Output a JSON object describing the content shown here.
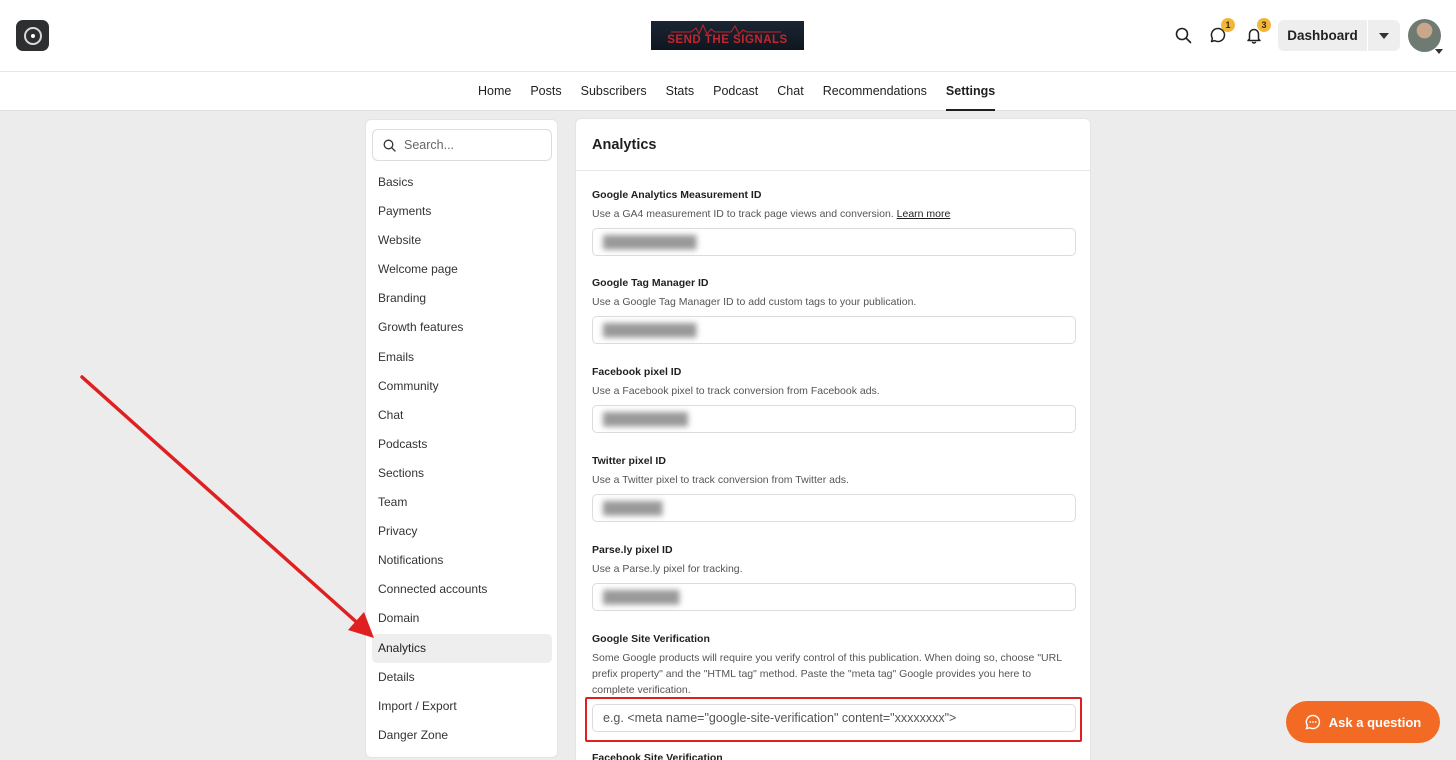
{
  "header": {
    "publication_banner": "SEND THE SIGNALS",
    "chat_badge": "1",
    "notifications_badge": "3",
    "dashboard_label": "Dashboard"
  },
  "nav": {
    "tabs": [
      {
        "label": "Home"
      },
      {
        "label": "Posts"
      },
      {
        "label": "Subscribers"
      },
      {
        "label": "Stats"
      },
      {
        "label": "Podcast"
      },
      {
        "label": "Chat"
      },
      {
        "label": "Recommendations"
      },
      {
        "label": "Settings",
        "active": true
      }
    ]
  },
  "sidebar": {
    "search_placeholder": "Search...",
    "items": [
      {
        "label": "Basics"
      },
      {
        "label": "Payments"
      },
      {
        "label": "Website"
      },
      {
        "label": "Welcome page"
      },
      {
        "label": "Branding"
      },
      {
        "label": "Growth features"
      },
      {
        "label": "Emails"
      },
      {
        "label": "Community"
      },
      {
        "label": "Chat"
      },
      {
        "label": "Podcasts"
      },
      {
        "label": "Sections"
      },
      {
        "label": "Team"
      },
      {
        "label": "Privacy"
      },
      {
        "label": "Notifications"
      },
      {
        "label": "Connected accounts"
      },
      {
        "label": "Domain"
      },
      {
        "label": "Analytics",
        "active": true
      },
      {
        "label": "Details"
      },
      {
        "label": "Import / Export"
      },
      {
        "label": "Danger Zone"
      }
    ]
  },
  "panel": {
    "title": "Analytics",
    "fields": {
      "ga": {
        "label": "Google Analytics Measurement ID",
        "desc": "Use a GA4 measurement ID to track page views and conversion.",
        "link": "Learn more"
      },
      "gtm": {
        "label": "Google Tag Manager ID",
        "desc": "Use a Google Tag Manager ID to add custom tags to your publication."
      },
      "fb": {
        "label": "Facebook pixel ID",
        "desc": "Use a Facebook pixel to track conversion from Facebook ads."
      },
      "tw": {
        "label": "Twitter pixel ID",
        "desc": "Use a Twitter pixel to track conversion from Twitter ads."
      },
      "parsely": {
        "label": "Parse.ly pixel ID",
        "desc": "Use a Parse.ly pixel for tracking."
      },
      "gsv": {
        "label": "Google Site Verification",
        "desc": "Some Google products will require you verify control of this publication. When doing so, choose \"URL prefix property\" and the \"HTML tag\" method. Paste the \"meta tag\" Google provides you here to complete verification.",
        "placeholder": "e.g. <meta name=\"google-site-verification\" content=\"xxxxxxxx\">"
      },
      "fsv": {
        "label": "Facebook Site Verification"
      }
    }
  },
  "help_button": {
    "label": "Ask a question"
  },
  "colors": {
    "annotation_red": "#e02020",
    "help_orange": "#f26a24",
    "badge_yellow": "#f2b63a"
  }
}
